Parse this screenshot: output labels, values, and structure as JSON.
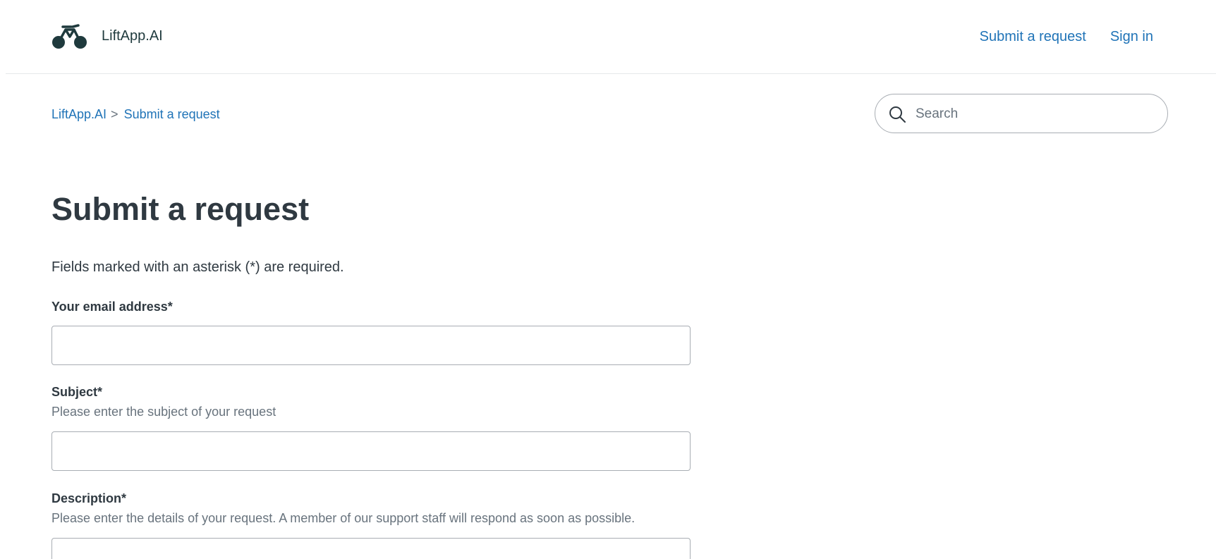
{
  "header": {
    "brand_name": "LiftApp.AI",
    "nav": {
      "submit_request": "Submit a request",
      "sign_in": "Sign in"
    }
  },
  "breadcrumb": {
    "home": "LiftApp.AI",
    "separator": ">",
    "current": "Submit a request"
  },
  "search": {
    "placeholder": "Search",
    "value": ""
  },
  "form": {
    "title": "Submit a request",
    "required_note": "Fields marked with an asterisk (*) are required.",
    "email": {
      "label": "Your email address*",
      "value": ""
    },
    "subject": {
      "label": "Subject*",
      "hint": "Please enter the subject of your request",
      "value": ""
    },
    "description": {
      "label": "Description*",
      "hint": "Please enter the details of your request. A member of our support staff will respond as soon as possible."
    }
  },
  "colors": {
    "link": "#1f73b7",
    "text": "#2f3941",
    "muted": "#68737d",
    "border": "#a8adb3",
    "logo": "#1f3a3d"
  }
}
